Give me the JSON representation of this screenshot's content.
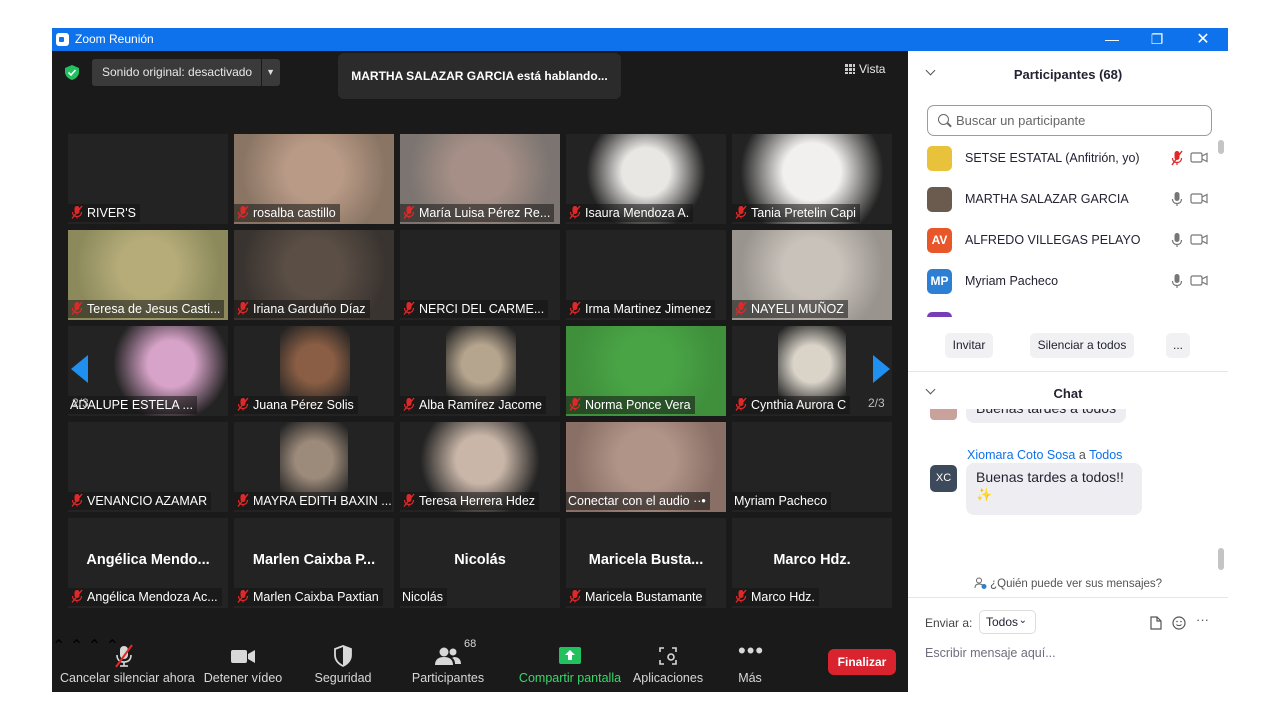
{
  "window": {
    "title": "Zoom Reunión"
  },
  "video": {
    "sound_dropdown": "Sonido original: desactivado",
    "speaking_banner": "MARTHA SALAZAR GARCIA está hablando...",
    "view_button": "Vista",
    "page_left": "2/3",
    "page_right": "2/3",
    "tiles": [
      {
        "name": "RIVER'S",
        "muted": true,
        "bg": "#232323"
      },
      {
        "name": "rosalba castillo",
        "muted": true,
        "bg": "#8a7564",
        "photo": "#b89a86"
      },
      {
        "name": "María Luisa Pérez Re...",
        "muted": true,
        "bg": "#7b7470",
        "photo": "#a58f86"
      },
      {
        "name": "Isaura Mendoza A.",
        "muted": true,
        "bg": "#232323",
        "photo": "#e9e7e4"
      },
      {
        "name": "Tania Pretelin Capi",
        "muted": true,
        "bg": "#232323",
        "photo": "#f2f0ee"
      },
      {
        "name": "Teresa de Jesus Casti...",
        "muted": true,
        "bg": "#8c8a5c",
        "photo": "#b6ac7a"
      },
      {
        "name": "Iriana Garduño Díaz",
        "muted": true,
        "bg": "#3a3430",
        "photo": "#5a4e45"
      },
      {
        "name": "NERCI  DEL  CARME...",
        "muted": true,
        "bg": "#232323"
      },
      {
        "name": "Irma Martinez Jimenez",
        "muted": true,
        "bg": "#232323"
      },
      {
        "name": "NAYELI MUÑOZ",
        "muted": true,
        "bg": "#9a948e",
        "photo": "#c8c2bb"
      },
      {
        "name": "ADALUPE ESTELA ...",
        "muted": false,
        "bg": "#232323",
        "photo": "#d7a3c8"
      },
      {
        "name": "Juana Pérez Solis",
        "muted": true,
        "bg": "#232323",
        "photo": "#8a5e44"
      },
      {
        "name": "Alba Ramírez Jacome",
        "muted": true,
        "bg": "#232323",
        "photo": "#b6a58e"
      },
      {
        "name": "Norma Ponce Vera",
        "muted": true,
        "bg": "#3f8f3b",
        "photo": "#49a445"
      },
      {
        "name": "Cynthia Aurora C",
        "muted": true,
        "bg": "#232323",
        "photo": "#d9d3c8"
      },
      {
        "name": "VENANCIO AZAMAR",
        "muted": true,
        "bg": "#232323"
      },
      {
        "name": "MAYRA EDITH BAXIN ...",
        "muted": true,
        "bg": "#232323",
        "photo": "#9c8a7a"
      },
      {
        "name": "Teresa Herrera Hdez",
        "muted": true,
        "bg": "#232323",
        "photo": "#c9b6a8"
      },
      {
        "name": "Conectar con el audio ··•",
        "muted": false,
        "bg": "#8a6f66",
        "photo": "#b09488"
      },
      {
        "name": "Myriam Pacheco",
        "muted": false,
        "bg": "#232323"
      },
      {
        "name": "Angélica Mendoza Ac...",
        "muted": true,
        "bg": "#232323",
        "big": "Angélica  Mendo..."
      },
      {
        "name": "Marlen Caixba Paxtian",
        "muted": true,
        "bg": "#232323",
        "big": "Marlen  Caixba  P..."
      },
      {
        "name": "Nicolás",
        "muted": false,
        "bg": "#232323",
        "big": "Nicolás"
      },
      {
        "name": "Maricela Bustamante",
        "muted": true,
        "bg": "#232323",
        "big": "Maricela  Busta..."
      },
      {
        "name": "Marco Hdz.",
        "muted": true,
        "bg": "#232323",
        "big": "Marco  Hdz."
      }
    ]
  },
  "toolbar": {
    "unmute": "Cancelar silenciar ahora",
    "stop_video": "Detener vídeo",
    "security": "Seguridad",
    "participants": "Participantes",
    "participants_count": "68",
    "share": "Compartir pantalla",
    "apps": "Aplicaciones",
    "more": "Más",
    "end": "Finalizar"
  },
  "participants": {
    "header": "Participantes (68)",
    "search_placeholder": "Buscar un participante",
    "list": [
      {
        "name": "SETSE ESTATAL (Anfitrión, yo)",
        "initials": "",
        "color": "#e8c23a",
        "mic_muted": true
      },
      {
        "name": "MARTHA SALAZAR GARCIA",
        "initials": "",
        "color": "#6b5a4e",
        "mic_muted": false
      },
      {
        "name": "ALFREDO VILLEGAS PELAYO",
        "initials": "AV",
        "color": "#e8572a",
        "mic_muted": false
      },
      {
        "name": "Myriam Pacheco",
        "initials": "MP",
        "color": "#2d7fd3",
        "mic_muted": false
      }
    ],
    "invite": "Invitar",
    "mute_all": "Silenciar a todos",
    "more": "..."
  },
  "chat": {
    "header": "Chat",
    "prev_message": "Buenas tardes a todos",
    "sender": "Xiomara Coto Sosa",
    "to_word": "a",
    "recipient": "Todos",
    "sender_initials": "XC",
    "message": "Buenas tardes a todos!!",
    "emoji": "✨",
    "who_can_see": "¿Quién puede ver sus mensajes?",
    "send_to_label": "Enviar a:",
    "send_to_value": "Todos",
    "input_placeholder": "Escribir mensaje aquí..."
  }
}
